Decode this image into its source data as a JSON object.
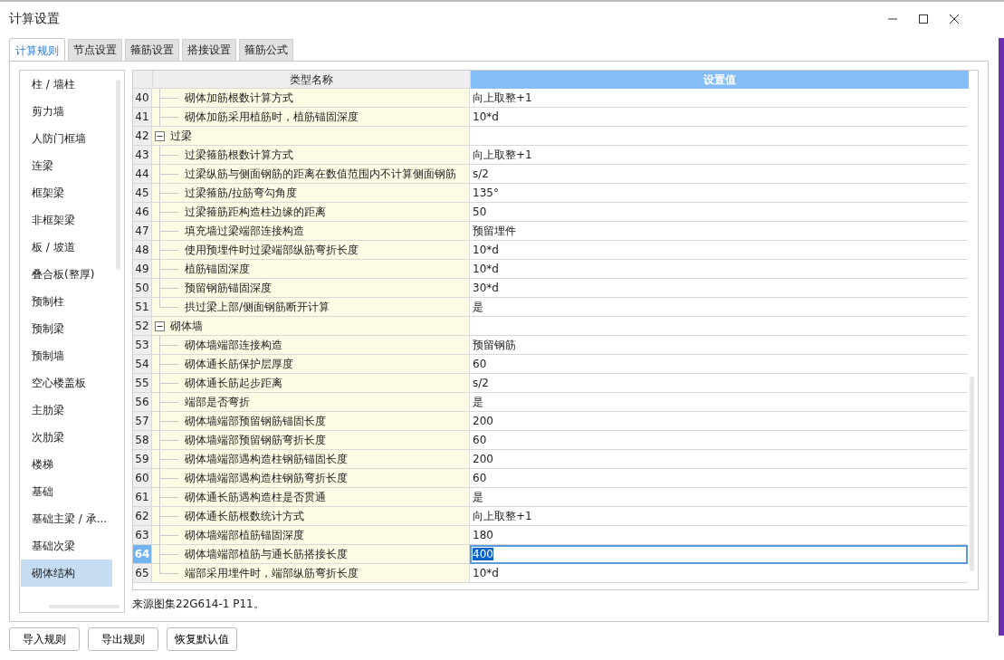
{
  "window": {
    "title": "计算设置"
  },
  "tabs": [
    {
      "label": "计算规则",
      "selected": true
    },
    {
      "label": "节点设置",
      "selected": false
    },
    {
      "label": "箍筋设置",
      "selected": false
    },
    {
      "label": "搭接设置",
      "selected": false
    },
    {
      "label": "箍筋公式",
      "selected": false
    }
  ],
  "sidebar": {
    "items": [
      {
        "label": "柱 / 墙柱",
        "selected": false
      },
      {
        "label": "剪力墙",
        "selected": false
      },
      {
        "label": "人防门框墙",
        "selected": false
      },
      {
        "label": "连梁",
        "selected": false
      },
      {
        "label": "框架梁",
        "selected": false
      },
      {
        "label": "非框架梁",
        "selected": false
      },
      {
        "label": "板 / 坡道",
        "selected": false
      },
      {
        "label": "叠合板(整厚)",
        "selected": false
      },
      {
        "label": "预制柱",
        "selected": false
      },
      {
        "label": "预制梁",
        "selected": false
      },
      {
        "label": "预制墙",
        "selected": false
      },
      {
        "label": "空心楼盖板",
        "selected": false
      },
      {
        "label": "主肋梁",
        "selected": false
      },
      {
        "label": "次肋梁",
        "selected": false
      },
      {
        "label": "楼梯",
        "selected": false
      },
      {
        "label": "基础",
        "selected": false
      },
      {
        "label": "基础主梁 / 承...",
        "selected": false
      },
      {
        "label": "基础次梁",
        "selected": false
      },
      {
        "label": "砌体结构",
        "selected": true
      }
    ]
  },
  "table": {
    "columns": [
      "类型名称",
      "设置值"
    ],
    "rows": [
      {
        "kind": "item",
        "number": "40",
        "name": "砌体加筋根数计算方式",
        "value": "向上取整+1",
        "selected": false
      },
      {
        "kind": "item",
        "number": "41",
        "name": "砌体加筋采用植筋时，植筋锚固深度",
        "value": "10*d",
        "selected": false
      },
      {
        "kind": "group",
        "number": "42",
        "name": "过梁",
        "expanded": true,
        "selected": false,
        "children": [
          {
            "kind": "item",
            "number": "43",
            "name": "过梁箍筋根数计算方式",
            "value": "向上取整+1",
            "selected": false
          },
          {
            "kind": "item",
            "number": "44",
            "name": "过梁纵筋与侧面钢筋的距离在数值范围内不计算侧面钢筋",
            "value": "s/2",
            "selected": false
          },
          {
            "kind": "item",
            "number": "45",
            "name": "过梁箍筋/拉筋弯勾角度",
            "value": "135°",
            "selected": false
          },
          {
            "kind": "item",
            "number": "46",
            "name": "过梁箍筋距构造柱边缘的距离",
            "value": "50",
            "selected": false
          },
          {
            "kind": "item",
            "number": "47",
            "name": "填充墙过梁端部连接构造",
            "value": "预留埋件",
            "selected": false
          },
          {
            "kind": "item",
            "number": "48",
            "name": "使用预埋件时过梁端部纵筋弯折长度",
            "value": "10*d",
            "selected": false
          },
          {
            "kind": "item",
            "number": "49",
            "name": "植筋锚固深度",
            "value": "10*d",
            "selected": false
          },
          {
            "kind": "item",
            "number": "50",
            "name": "预留钢筋锚固深度",
            "value": "30*d",
            "selected": false
          },
          {
            "kind": "item",
            "number": "51",
            "name": "拱过梁上部/侧面钢筋断开计算",
            "value": "是",
            "selected": false
          }
        ]
      },
      {
        "kind": "group",
        "number": "52",
        "name": "砌体墙",
        "expanded": true,
        "selected": false,
        "children": [
          {
            "kind": "item",
            "number": "53",
            "name": "砌体墙端部连接构造",
            "value": "预留钢筋",
            "selected": false
          },
          {
            "kind": "item",
            "number": "54",
            "name": "砌体通长筋保护层厚度",
            "value": "60",
            "selected": false
          },
          {
            "kind": "item",
            "number": "55",
            "name": "砌体通长筋起步距离",
            "value": "s/2",
            "selected": false
          },
          {
            "kind": "item",
            "number": "56",
            "name": "端部是否弯折",
            "value": "是",
            "selected": false
          },
          {
            "kind": "item",
            "number": "57",
            "name": "砌体墙端部预留钢筋锚固长度",
            "value": "200",
            "selected": false
          },
          {
            "kind": "item",
            "number": "58",
            "name": "砌体墙端部预留钢筋弯折长度",
            "value": "60",
            "selected": false
          },
          {
            "kind": "item",
            "number": "59",
            "name": "砌体墙端部遇构造柱钢筋锚固长度",
            "value": "200",
            "selected": false
          },
          {
            "kind": "item",
            "number": "60",
            "name": "砌体墙端部遇构造柱钢筋弯折长度",
            "value": "60",
            "selected": false
          },
          {
            "kind": "item",
            "number": "61",
            "name": "砌体通长筋遇构造柱是否贯通",
            "value": "是",
            "selected": false
          },
          {
            "kind": "item",
            "number": "62",
            "name": "砌体通长筋根数统计方式",
            "value": "向上取整+1",
            "selected": false
          },
          {
            "kind": "item",
            "number": "63",
            "name": "砌体墙端部植筋锚固深度",
            "value": "180",
            "selected": false
          },
          {
            "kind": "item",
            "number": "64",
            "name": "砌体墙端部植筋与通长筋搭接长度",
            "value": "400",
            "selected": true
          },
          {
            "kind": "item",
            "number": "65",
            "name": "端部采用埋件时，端部纵筋弯折长度",
            "value": "10*d",
            "selected": false
          }
        ]
      }
    ]
  },
  "source_note": "来源图集22G614-1 P11。",
  "buttons": [
    "导入规则",
    "导出规则",
    "恢复默认值"
  ]
}
